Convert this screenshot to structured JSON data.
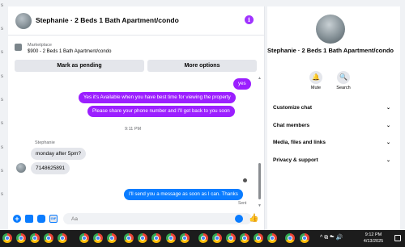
{
  "left_strip": {
    "ticks": [
      "s",
      "s",
      "s",
      "s",
      "s",
      "s",
      "s",
      "s",
      "s"
    ]
  },
  "chat": {
    "title": "Stephanie · 2 Beds 1 Bath Apartment/condo",
    "info_icon": "i",
    "listing": {
      "kicker": "Marketplace",
      "title": "$900 - 2 Beds 1 Bath Apartment/condo",
      "mark_pending": "Mark as pending",
      "more_options": "More options"
    },
    "messages": {
      "out_yes": "yes",
      "out_available": "Yes it's Available when you have best time for viewing the property",
      "out_share": "Please share your phone number and I'll get back to you soon",
      "time_divider": "9:11 PM",
      "sender_name": "Stephanie",
      "in_monday": "monday after 5pm?",
      "in_phone": "7148625891",
      "out_thanks": "I'll send you a message as soon as I can. Thanks",
      "sent_label": "Sent"
    },
    "composer": {
      "placeholder": "Aa",
      "plus": "+",
      "gif": "GIF",
      "like": "👍"
    }
  },
  "right_panel": {
    "name": "Stephanie · 2 Beds 1 Bath Apartment/condo",
    "mute_label": "Mute",
    "search_label": "Search",
    "mute_icon": "🔔",
    "search_icon": "🔍",
    "rows": [
      "Customize chat",
      "Chat members",
      "Media, files and links",
      "Privacy & support"
    ],
    "chevron": "⌄"
  },
  "taskbar": {
    "tray": "^ ⧉ ☁ 🔊",
    "time": "9:12 PM",
    "date": "4/13/2025"
  },
  "colors": {
    "purple_bubble": "#9b1fff",
    "blue_bubble": "#0a7cff",
    "incoming_bubble": "#e4e6eb",
    "taskbar": "#1c1c1c"
  }
}
